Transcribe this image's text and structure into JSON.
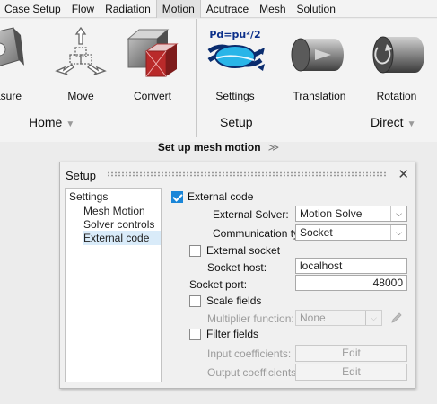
{
  "menu": {
    "items": [
      {
        "label": "Case Setup"
      },
      {
        "label": "Flow"
      },
      {
        "label": "Radiation"
      },
      {
        "label": "Motion"
      },
      {
        "label": "Acutrace"
      },
      {
        "label": "Mesh"
      },
      {
        "label": "Solution"
      }
    ],
    "active": "Motion"
  },
  "ribbon": {
    "tools": {
      "measure": "asure",
      "move": "Move",
      "convert": "Convert",
      "settings": "Settings",
      "translation": "Translation",
      "rotation": "Rotation"
    },
    "settings_formula": "Pd=pu²/2",
    "groups": {
      "home": "Home",
      "setup": "Setup",
      "direct": "Direct"
    }
  },
  "section_title": "Set up mesh motion",
  "dialog": {
    "title": "Setup",
    "tree": {
      "root": "Settings",
      "items": [
        "Mesh Motion",
        "Solver controls",
        "External code"
      ],
      "selected": "External code"
    },
    "form": {
      "external_code": {
        "label": "External code",
        "checked": true
      },
      "external_solver": {
        "label": "External Solver:",
        "value": "Motion Solve"
      },
      "communication_type": {
        "label": "Communication type:",
        "value": "Socket"
      },
      "external_socket": {
        "label": "External socket",
        "checked": false
      },
      "socket_host": {
        "label": "Socket host:",
        "value": "localhost"
      },
      "socket_port": {
        "label": "Socket port:",
        "value": "48000"
      },
      "scale_fields": {
        "label": "Scale fields",
        "checked": false
      },
      "multiplier_function": {
        "label": "Multiplier function:",
        "value": "None"
      },
      "filter_fields": {
        "label": "Filter fields",
        "checked": false
      },
      "input_coefficients": {
        "label": "Input coefficients:",
        "button": "Edit"
      },
      "output_coefficients": {
        "label": "Output coefficients:",
        "button": "Edit"
      }
    }
  },
  "colors": {
    "accent": "#1a86d8",
    "selection": "#d9ebf9",
    "disabled_text": "#9b9b9b"
  }
}
